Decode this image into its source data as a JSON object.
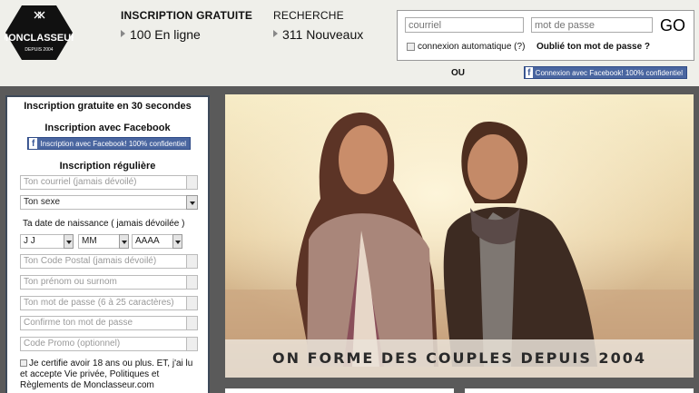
{
  "logo": {
    "brand": "MONCLASSEUR",
    "since": "DEPUIS 2004"
  },
  "stats": {
    "signup_label": "INSCRIPTION GRATUITE",
    "online": "100 En ligne",
    "search_label": "RECHERCHE",
    "new_members": "311 Nouveaux"
  },
  "login": {
    "email_placeholder": "courriel",
    "password_placeholder": "mot de passe",
    "go_label": "GO",
    "auto_login": "connexion automatique (?)",
    "forgot": "Oublié ton mot de passe ?",
    "or": "OU",
    "facebook": "Connexion avec Facebook! 100% confidentiel"
  },
  "signup": {
    "title": "Inscription gratuite en 30 secondes",
    "facebook_heading": "Inscription avec Facebook",
    "facebook_button": "Inscription avec Facebook! 100% confidentiel",
    "regular_heading": "Inscription régulière",
    "email_placeholder": "Ton courriel (jamais dévoilé)",
    "gender_value": "Ton sexe",
    "birthdate_label": "Ta date de naissance ( jamais dévoilée )",
    "day_value": "J J",
    "month_value": "MM",
    "year_value": "AAAA",
    "postal_placeholder": "Ton Code Postal (jamais dévoilé)",
    "firstname_placeholder": "Ton prénom ou surnom",
    "password_placeholder": "Ton mot de passe (6 à 25 caractères)",
    "confirm_placeholder": "Confirme ton mot de passe",
    "promo_placeholder": "Code Promo (optionnel)",
    "certify": "Je certifie avoir 18 ans ou plus. ET, j'ai lu et accepte Vie privée, Politiques et Règlements de Monclasseur.com"
  },
  "hero": {
    "tagline": "ON FORME DES COUPLES DEPUIS 2004"
  },
  "colors": {
    "facebook": "#4a66a0",
    "header_bg": "#efefea",
    "page_bg": "#5a5a5a",
    "panel_border": "#3d4a5a"
  }
}
